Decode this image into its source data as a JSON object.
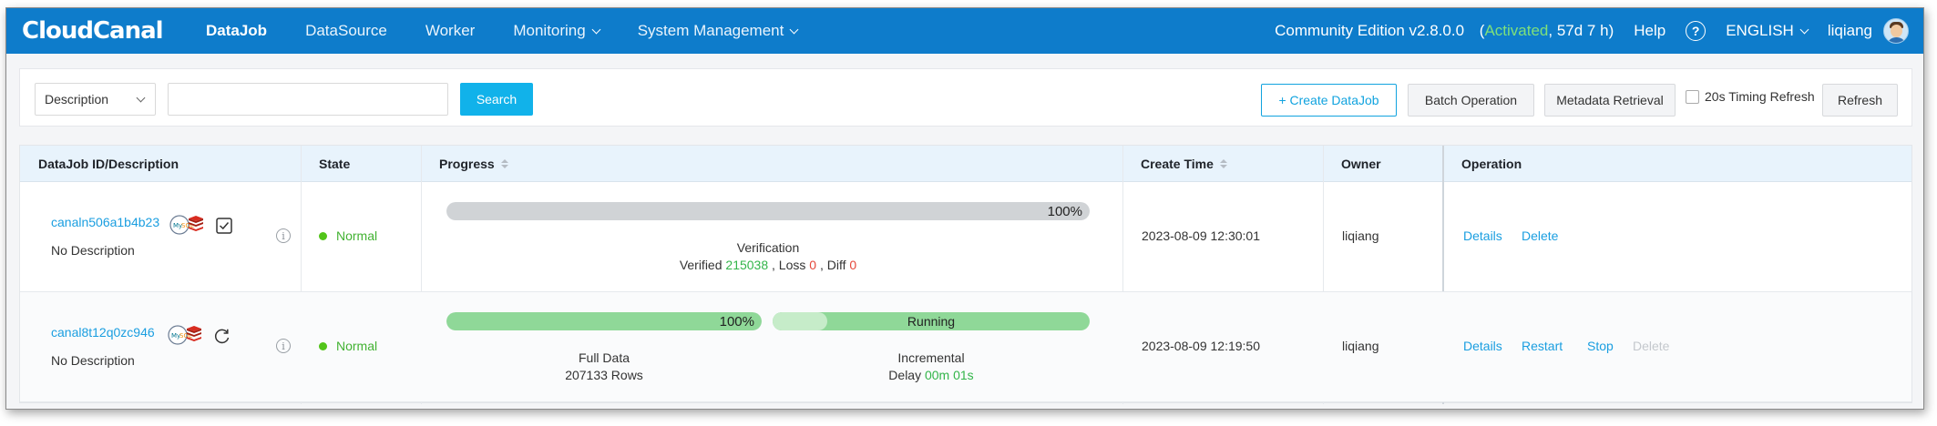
{
  "nav": {
    "logo": "CloudCanal",
    "menu": [
      {
        "label": "DataJob",
        "active": true,
        "dropdown": false
      },
      {
        "label": "DataSource",
        "active": false,
        "dropdown": false
      },
      {
        "label": "Worker",
        "active": false,
        "dropdown": false
      },
      {
        "label": "Monitoring",
        "active": false,
        "dropdown": true
      },
      {
        "label": "System Management",
        "active": false,
        "dropdown": true
      }
    ],
    "edition": "Community Edition v2.8.0.0",
    "license_open": "(",
    "license_status": "Activated",
    "license_sep": ", ",
    "license_days": "57d 7 h",
    "license_close": ")",
    "help": "Help",
    "help_icon": "?",
    "language": "ENGLISH",
    "user": "liqiang",
    "color_primary": "#0e7ccb",
    "color_activated": "#7fe07a"
  },
  "toolbar": {
    "filter_select": "Description",
    "search_value": "",
    "search_placeholder": "",
    "search_button": "Search",
    "create_button": "+ Create DataJob",
    "batch_button": "Batch Operation",
    "metadata_button": "Metadata Retrieval",
    "timing_refresh_label": "20s Timing Refresh",
    "timing_refresh_checked": false,
    "refresh_button": "Refresh"
  },
  "table": {
    "headers": {
      "id": "DataJob ID/Description",
      "state": "State",
      "progress": "Progress",
      "create_time": "Create Time",
      "owner": "Owner",
      "operation": "Operation"
    },
    "rows": [
      {
        "id": "canaln506a1b4b23",
        "description": "No Description",
        "source_icon": "mysql-icon",
        "target_icon": "redis-icon",
        "task_icon": "checkbox-task-icon",
        "info_icon": "i",
        "state": "Normal",
        "progress": {
          "bar_value": 1.0,
          "bar_label": "100%",
          "stage": "Verification",
          "verified_label": "Verified ",
          "verified": "215038",
          "loss_label": " , Loss ",
          "loss": "0",
          "diff_label": " , Diff ",
          "diff": "0"
        },
        "create_time": "2023-08-09 12:30:01",
        "owner": "liqiang",
        "operations": [
          "Details",
          "Delete"
        ]
      },
      {
        "id": "canal8t12q0zc946",
        "description": "No Description",
        "source_icon": "mysql-icon",
        "target_icon": "redis-icon",
        "task_icon": "sync-loop-icon",
        "info_icon": "i",
        "state": "Normal",
        "progress": {
          "full_value": 1.0,
          "full_label": "100%",
          "full_stage": "Full Data",
          "full_rows": "207133 Rows",
          "incr_status": "Running",
          "incr_stage": "Incremental",
          "delay_label": "Delay ",
          "delay": "00m 01s"
        },
        "create_time": "2023-08-09 12:19:50",
        "owner": "liqiang",
        "operations": [
          "Details",
          "Restart",
          "Stop",
          "Delete"
        ],
        "operations_disabled": [
          false,
          false,
          false,
          true
        ]
      }
    ]
  }
}
